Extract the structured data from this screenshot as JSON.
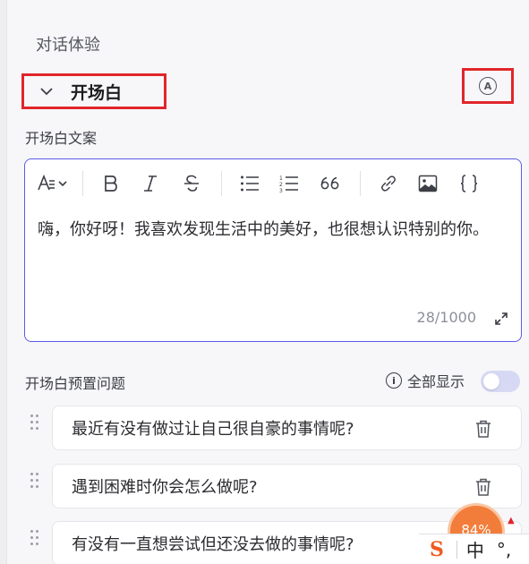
{
  "section": {
    "title": "对话体验"
  },
  "opening": {
    "collapse_title": "开场白",
    "auto_icon": "A",
    "field_label": "开场白文案",
    "editor_text": "嗨，你好呀！我喜欢发现生活中的美好，也很想认识特别的你。",
    "counter": "28/1000",
    "toolbar": [
      "text-style-icon",
      "bold-icon",
      "italic-icon",
      "strikethrough-icon",
      "bullet-list-icon",
      "numbered-list-icon",
      "quote-icon",
      "link-icon",
      "image-icon",
      "code-block-icon"
    ]
  },
  "presets": {
    "label": "开场白预置问题",
    "show_all_label": "全部显示",
    "show_all_on": false,
    "questions": [
      "最近有没有做过让自己很自豪的事情呢?",
      "遇到困难时你会怎么做呢?",
      "有没有一直想尝试但还没去做的事情呢?"
    ]
  },
  "overlay": {
    "badge_percent": "84%",
    "ime_mode": "中",
    "ime_punct": "°,"
  },
  "colors": {
    "accent": "#5b5be8",
    "highlight": "#e0262b",
    "badge": "#f27d3a"
  }
}
